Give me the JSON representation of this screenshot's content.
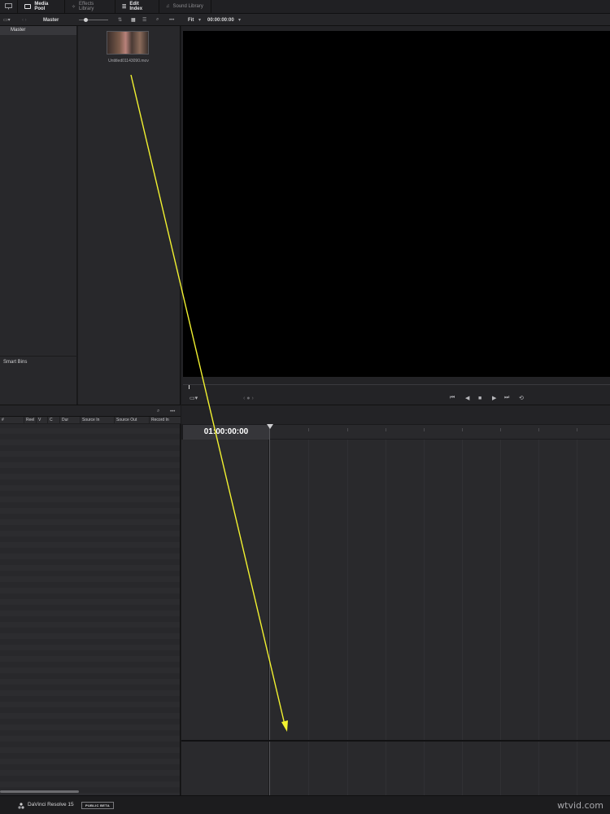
{
  "tabs": [
    {
      "label": "Media Pool",
      "active": true
    },
    {
      "label": "Effects Library",
      "active": false
    },
    {
      "label": "Edit Index",
      "active": true
    },
    {
      "label": "Sound Library",
      "active": false
    }
  ],
  "toolbar": {
    "bin_path": "Master",
    "viewer_zoom": "Fit",
    "viewer_timecode": "00:00:00:00"
  },
  "bins": {
    "master": "Master",
    "smart_bins": "Smart Bins"
  },
  "clip": {
    "name": "Untitled01143090.mov"
  },
  "edit_index": {
    "columns": [
      "#",
      "Reel",
      "V",
      "C",
      "Dur",
      "Source In",
      "Source Out",
      "Record In"
    ]
  },
  "timeline": {
    "timecode": "01:00:00:00"
  },
  "status": {
    "app_name": "DaVinci Resolve 15",
    "badge": "PUBLIC BETA",
    "watermark": "wtvid.com"
  },
  "colors": {
    "annotation_arrow": "#f2f230"
  }
}
